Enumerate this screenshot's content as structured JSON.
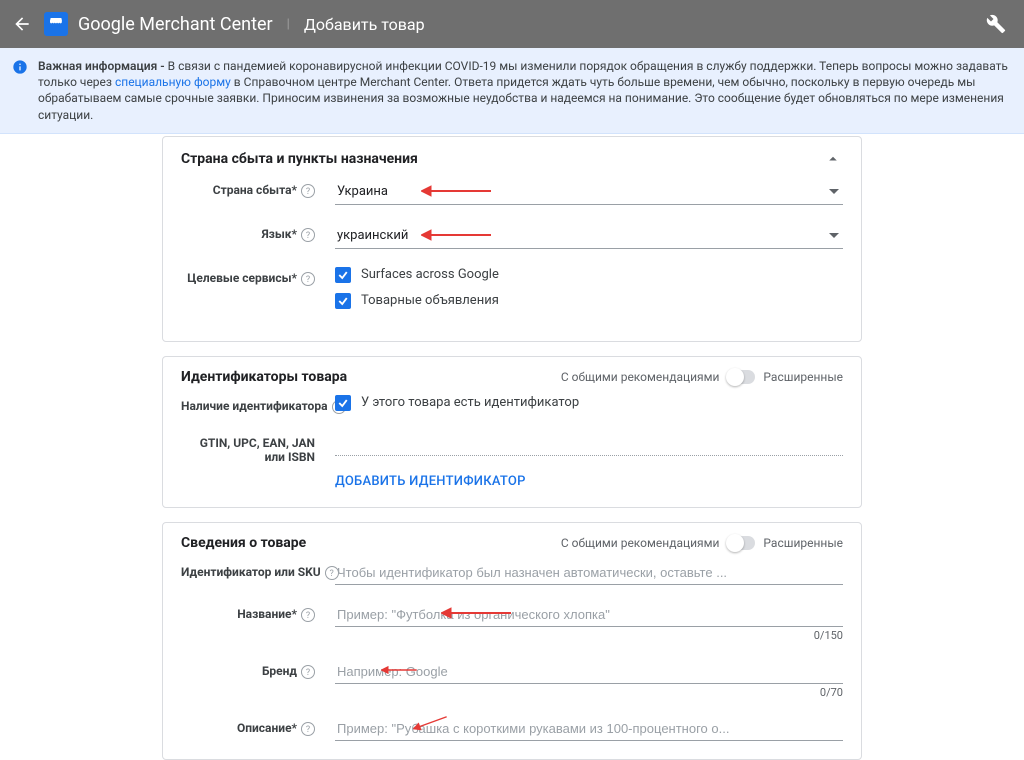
{
  "header": {
    "brand_html": "Google Merchant Center",
    "page_title": "Добавить товар"
  },
  "notice": {
    "lead": "Важная информация - ",
    "body1": "В связи с пандемией коронавирусной инфекции COVID-19 мы изменили порядок обращения в службу поддержки. Теперь вопросы можно задавать только через ",
    "link": "специальную форму",
    "body2": " в Справочном центре Merchant Center. Ответа придется ждать чуть больше времени, чем обычно, поскольку в первую очередь мы обрабатываем самые срочные заявки. Приносим извинения за возможные неудобства и надеемся на понимание. Это сообщение будет обновляться по мере изменения ситуации."
  },
  "toggle": {
    "left": "С общими рекомендациями",
    "right": "Расширенные"
  },
  "card_country": {
    "title": "Страна сбыта и пункты назначения",
    "labels": {
      "country": "Страна сбыта",
      "lang": "Язык",
      "dest": "Целевые сервисы"
    },
    "values": {
      "country": "Украина",
      "lang": "украинский"
    },
    "dest_items": {
      "surfaces": "Surfaces across Google",
      "ads": "Товарные объявления"
    }
  },
  "card_ids": {
    "title": "Идентификаторы товара",
    "labels": {
      "has_id": "Наличие идентификатора",
      "gtin": "GTIN, UPC, EAN, JAN или ISBN"
    },
    "has_id_text": "У этого товара есть идентификатор",
    "add_id_btn": "ДОБАВИТЬ ИДЕНТИФИКАТОР"
  },
  "card_info": {
    "title": "Сведения о товаре",
    "labels": {
      "sku": "Идентификатор или SKU",
      "name": "Название",
      "brand": "Бренд",
      "desc": "Описание"
    },
    "placeholders": {
      "sku": "Чтобы идентификатор был назначен автоматически, оставьте ...",
      "name": "Пример: \"Футболка из органического хлопка\"",
      "brand": "Например: Google",
      "desc": "Пример: \"Рубашка с короткими рукавами из 100-процентного о..."
    },
    "counters": {
      "name": "0/150",
      "brand": "0/70"
    }
  }
}
